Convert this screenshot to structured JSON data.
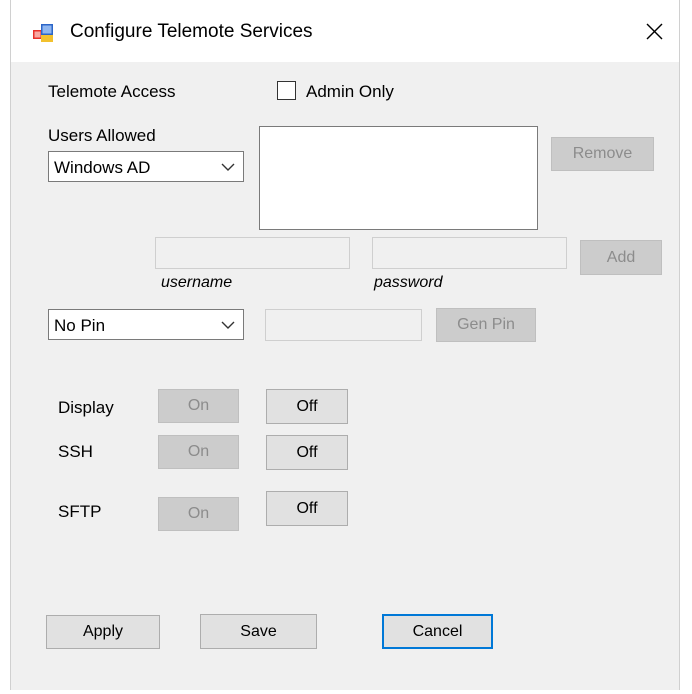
{
  "window": {
    "title": "Configure Telemote Services"
  },
  "access": {
    "label": "Telemote Access",
    "admin_only_label": "Admin Only",
    "admin_only_checked": false
  },
  "users": {
    "label": "Users Allowed",
    "source_selected": "Windows AD",
    "remove_label": "Remove",
    "username_value": "",
    "username_caption": "username",
    "password_value": "",
    "password_caption": "password",
    "add_label": "Add"
  },
  "pin": {
    "mode_selected": "No Pin",
    "pin_value": "",
    "gen_label": "Gen Pin"
  },
  "services": [
    {
      "name": "Display",
      "on_label": "On",
      "off_label": "Off"
    },
    {
      "name": "SSH",
      "on_label": "On",
      "off_label": "Off"
    },
    {
      "name": "SFTP",
      "on_label": "On",
      "off_label": "Off"
    }
  ],
  "footer": {
    "apply_label": "Apply",
    "save_label": "Save",
    "cancel_label": "Cancel"
  },
  "colors": {
    "window_bg": "#f0f0f0",
    "disabled_button": "#cccccc",
    "default_button_border": "#0078d7"
  },
  "icons": {
    "app": "telemote-app-icon",
    "close": "close-icon",
    "dropdown": "chevron-down-icon"
  }
}
